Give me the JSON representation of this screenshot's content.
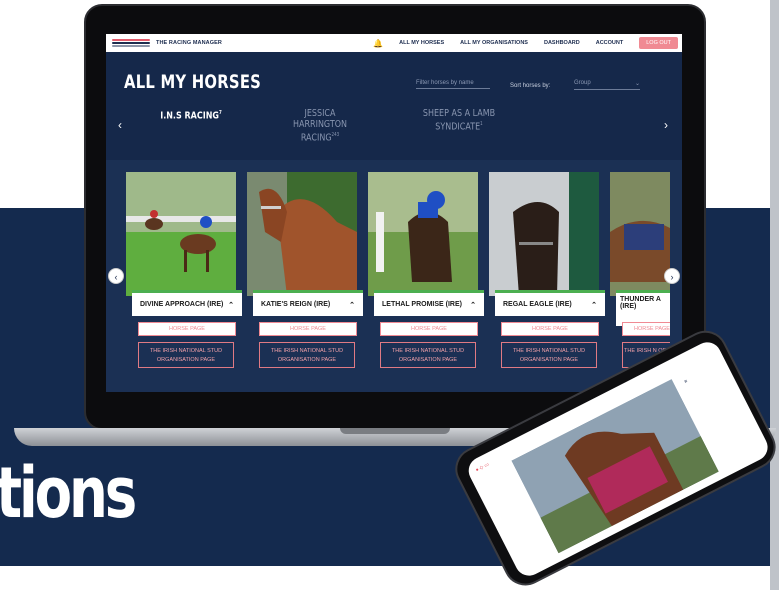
{
  "hero": {
    "big_word": "tions"
  },
  "app": {
    "logo_text": "THE RACING MANAGER",
    "nav": [
      "ALL MY HORSES",
      "ALL MY ORGANISATIONS",
      "DASHBOARD",
      "ACCOUNT"
    ],
    "logout": "LOG OUT",
    "page_title": "ALL MY HORSES",
    "filter_placeholder": "Filter horses by name",
    "sort_label": "Sort horses by:",
    "sort_value": "Group",
    "orgs": [
      {
        "name": "I.N.S RACING",
        "count": "7"
      },
      {
        "name": "JESSICA HARRINGTON RACING",
        "count": "243"
      },
      {
        "name": "SHEEP AS A LAMB SYNDICATE",
        "count": "1"
      }
    ],
    "horses": [
      {
        "name": "DIVINE APPROACH (IRE)"
      },
      {
        "name": "KATIE'S REIGN (IRE)"
      },
      {
        "name": "LETHAL PROMISE (IRE)"
      },
      {
        "name": "REGAL EAGLE (IRE)"
      },
      {
        "name": "THUNDER A (IRE)"
      }
    ],
    "horse_page_label": "HORSE PAGE",
    "org_page_label": "THE IRISH NATIONAL STUD ORGANISATION PAGE",
    "org_page_label_partial": "THE IRISH N ORGANI"
  },
  "colors": {
    "navy": "#142a4e",
    "screen_bg": "#15284a",
    "accent_pink": "#f08a93",
    "accent_green": "#4caf50"
  }
}
